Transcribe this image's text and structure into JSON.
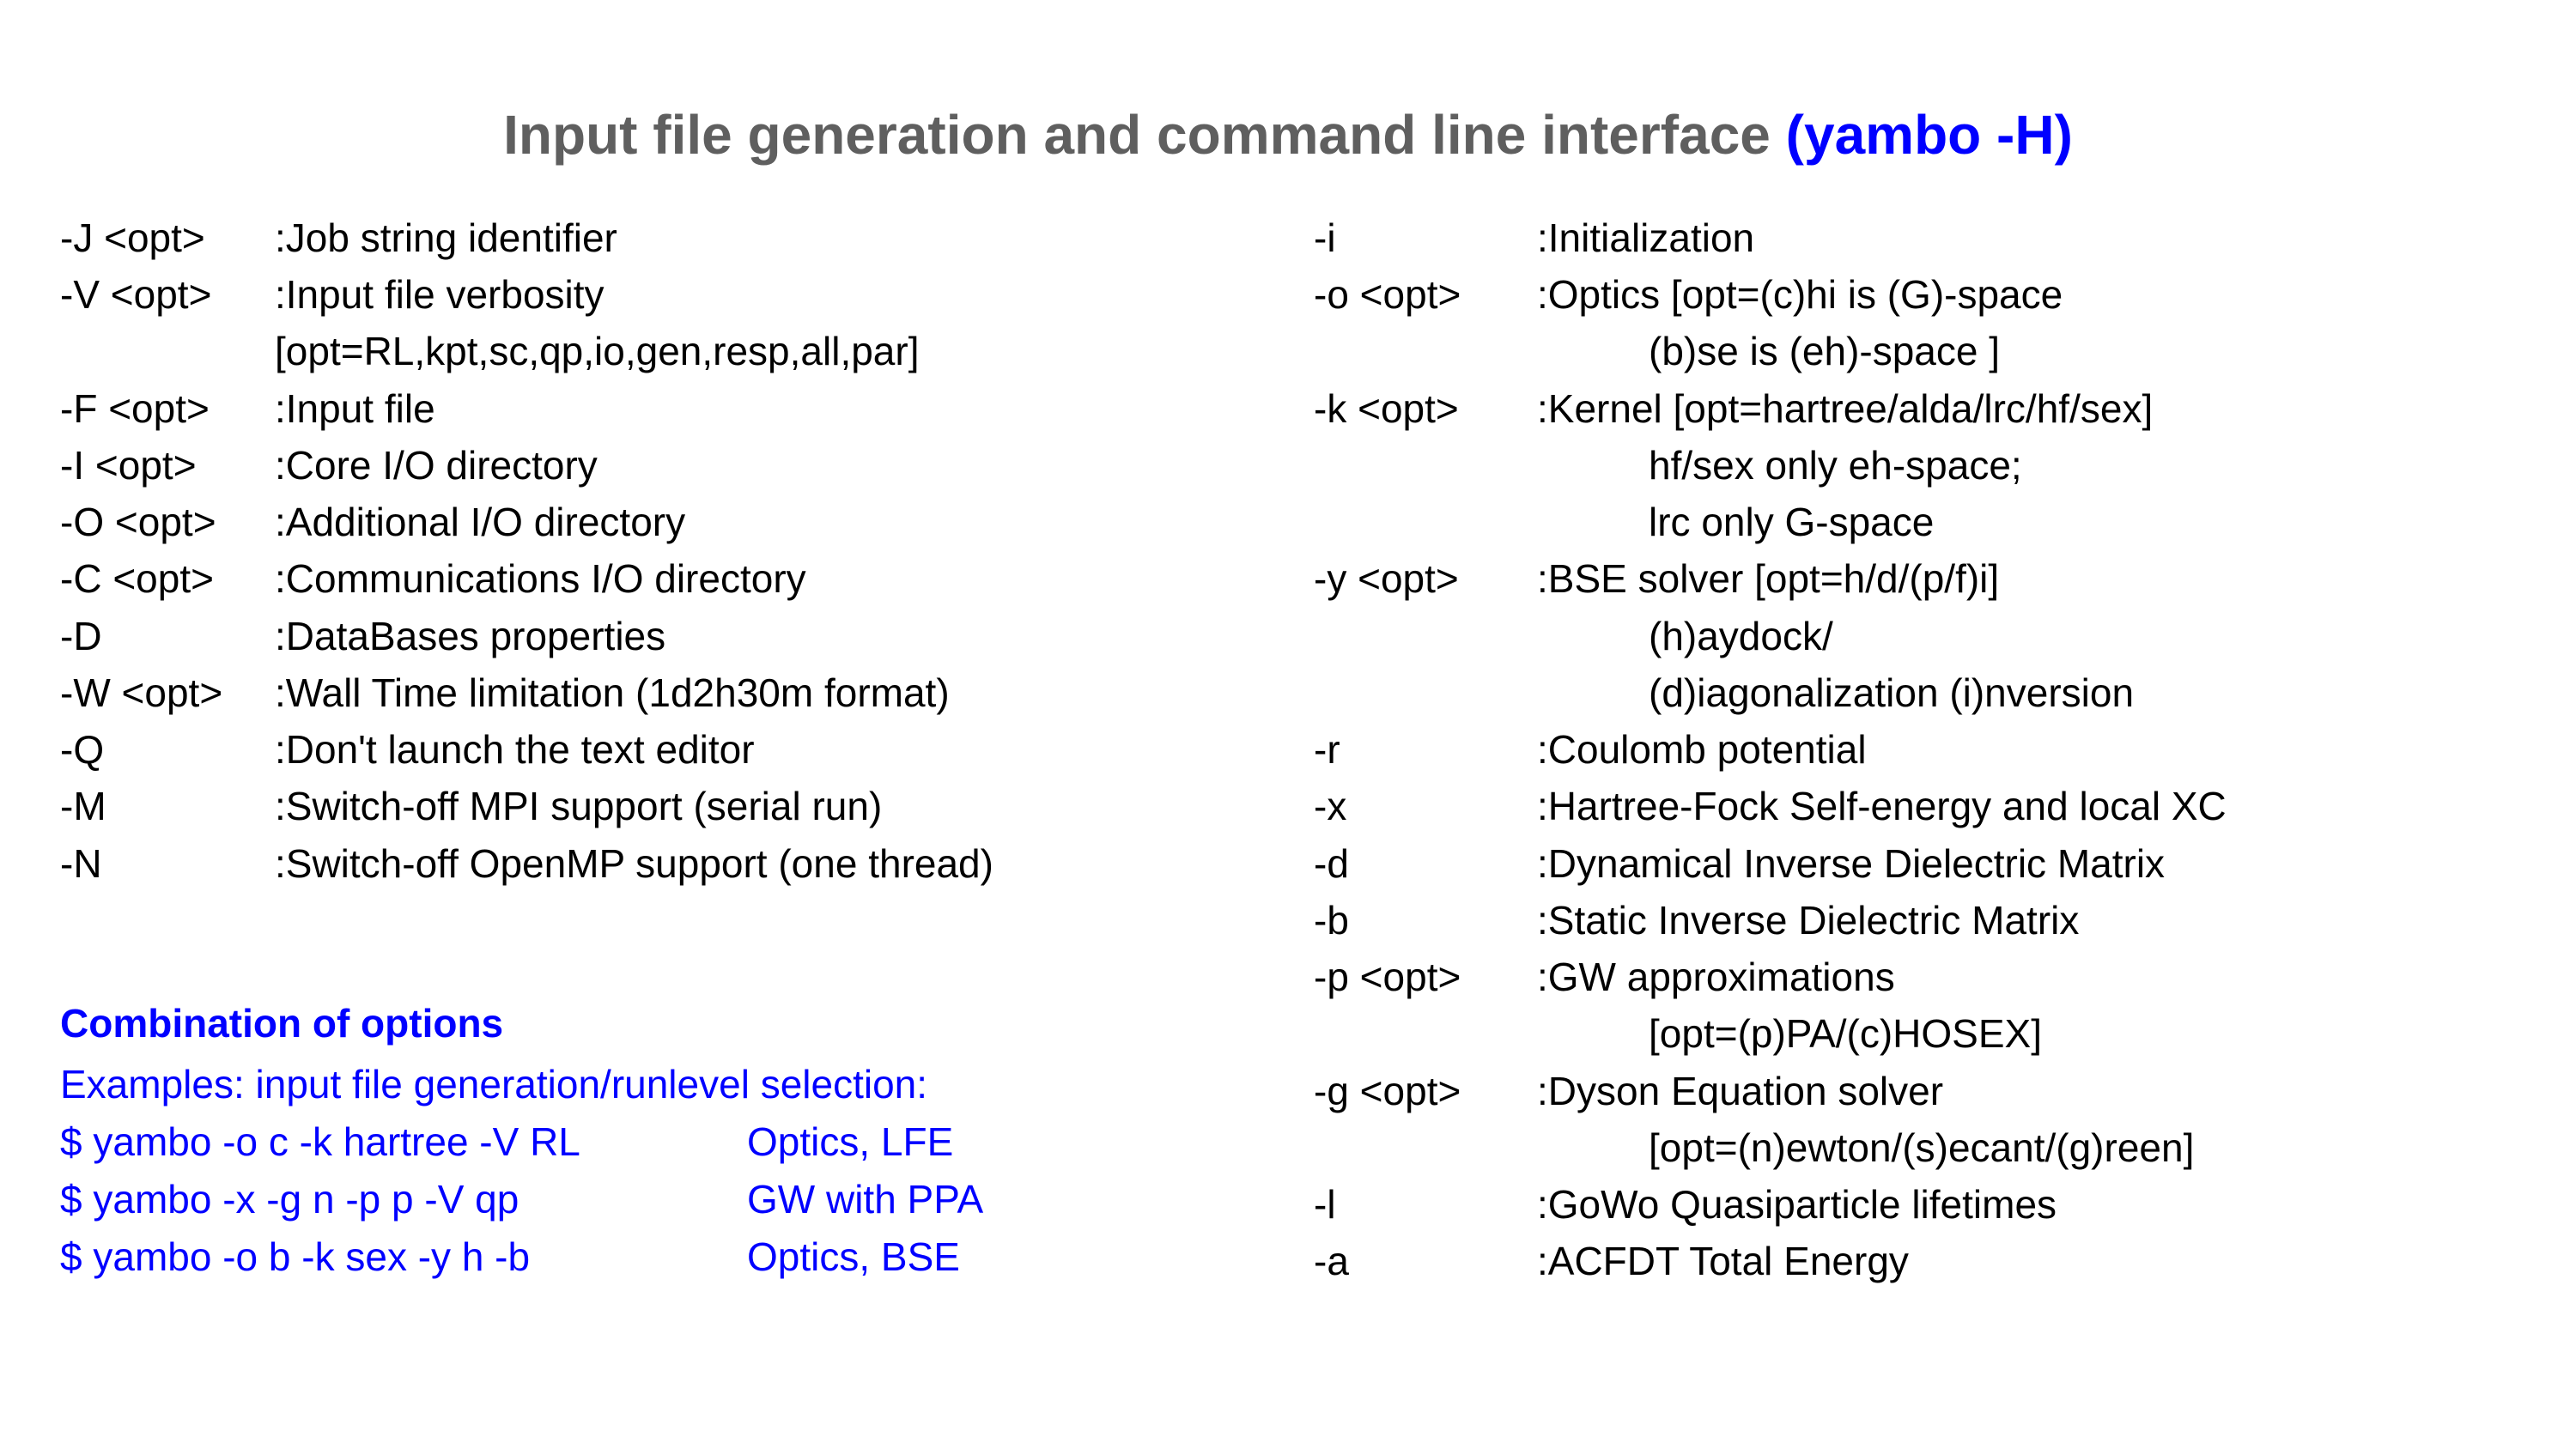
{
  "title_main": "Input file generation and command line interface ",
  "title_blue": "(yambo -H)",
  "left": [
    {
      "flag": "-J <opt>",
      "desc": ":Job string identifier"
    },
    {
      "flag": "-V <opt>",
      "desc": ":Input file verbosity"
    },
    {
      "flag": "",
      "desc": " [opt=RL,kpt,sc,qp,io,gen,resp,all,par]"
    },
    {
      "flag": "-F <opt>",
      "desc": ":Input file"
    },
    {
      "flag": "-I <opt>",
      "desc": ":Core I/O directory"
    },
    {
      "flag": "-O <opt>",
      "desc": ":Additional I/O directory"
    },
    {
      "flag": "-C <opt>",
      "desc": ":Communications I/O directory"
    },
    {
      "flag": "-D",
      "desc": ":DataBases properties"
    },
    {
      "flag": "-W <opt>",
      "desc": ":Wall Time limitation (1d2h30m format)"
    },
    {
      "flag": "-Q",
      "desc": ":Don't launch the text editor"
    },
    {
      "flag": "-M",
      "desc": ":Switch-off MPI support (serial run)"
    },
    {
      "flag": "-N",
      "desc": ":Switch-off OpenMP support (one thread)"
    }
  ],
  "right": [
    {
      "flag": "-i",
      "desc": ":Initialization"
    },
    {
      "flag": "-o <opt>",
      "desc": ":Optics [opt=(c)hi is (G)-space"
    },
    {
      "flag": "",
      "desc": "(b)se is (eh)-space ]",
      "indent": true
    },
    {
      "flag": "-k <opt>",
      "desc": ":Kernel [opt=hartree/alda/lrc/hf/sex]"
    },
    {
      "flag": "",
      "desc": "hf/sex only eh-space;",
      "indent": true
    },
    {
      "flag": "",
      "desc": "lrc only G-space",
      "indent": true
    },
    {
      "flag": "-y <opt>",
      "desc": ":BSE solver [opt=h/d/(p/f)i]"
    },
    {
      "flag": "",
      "desc": "(h)aydock/",
      "indent": true
    },
    {
      "flag": "",
      "desc": "(d)iagonalization (i)nversion",
      "indent": true
    },
    {
      "flag": "-r",
      "desc": ":Coulomb potential"
    },
    {
      "flag": "-x",
      "desc": ":Hartree-Fock Self-energy and local XC"
    },
    {
      "flag": "-d",
      "desc": ":Dynamical Inverse Dielectric Matrix"
    },
    {
      "flag": "-b",
      "desc": ":Static Inverse Dielectric Matrix"
    },
    {
      "flag": "-p <opt>",
      "desc": ":GW approximations"
    },
    {
      "flag": "",
      "desc": "[opt=(p)PA/(c)HOSEX]",
      "indent": true
    },
    {
      "flag": "-g <opt>",
      "desc": ":Dyson Equation solver"
    },
    {
      "flag": "",
      "desc": "[opt=(n)ewton/(s)ecant/(g)reen]",
      "indent": true
    },
    {
      "flag": "-l",
      "desc": ":GoWo Quasiparticle lifetimes"
    },
    {
      "flag": "-a",
      "desc": ":ACFDT Total Energy"
    }
  ],
  "combo": {
    "title": "Combination of options",
    "intro": "Examples:  input file generation/runlevel selection:",
    "rows": [
      {
        "cmd": "$ yambo -o c -k hartree -V RL",
        "label": "Optics, LFE"
      },
      {
        "cmd": "$ yambo -x -g n -p p -V qp",
        "label": "GW with PPA"
      },
      {
        "cmd": "$ yambo -o b -k sex -y h -b",
        "label": "Optics, BSE"
      }
    ]
  }
}
